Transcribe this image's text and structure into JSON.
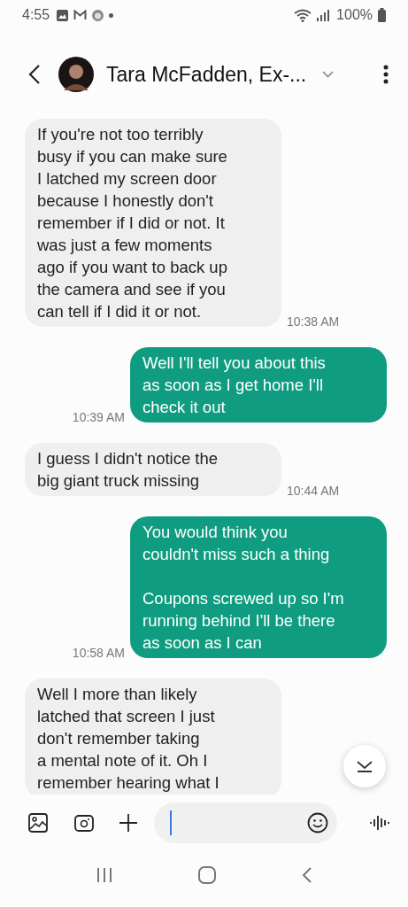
{
  "status_bar": {
    "time": "4:55",
    "battery": "100%"
  },
  "header": {
    "contact": "Tara McFadden, Ex-..."
  },
  "messages": [
    {
      "kind": "received",
      "text": "If you're not too terribly\nbusy if you can make sure\nI latched my screen door\nbecause I honestly don't\nremember if I did or not. It\nwas just a few moments\nago if you want to back up\nthe camera and see if you\ncan tell if I did it or not.",
      "time": "10:38 AM"
    },
    {
      "kind": "sent",
      "text": "Well I'll tell you about this\nas soon as I get home I'll\ncheck it out",
      "time": "10:39 AM"
    },
    {
      "kind": "received",
      "text": "I guess I didn't notice the\nbig giant truck missing",
      "time": "10:44 AM"
    },
    {
      "kind": "sent",
      "text": "You would think you\ncouldn't miss such a thing\n\nCoupons screwed up so I'm\nrunning behind I'll be there\nas soon as I can",
      "time": "10:58 AM"
    },
    {
      "kind": "received",
      "text": "Well I more than likely\nlatched that screen I just\ndon't remember taking\na mental note of it. Oh I\nremember hearing what I"
    }
  ]
}
